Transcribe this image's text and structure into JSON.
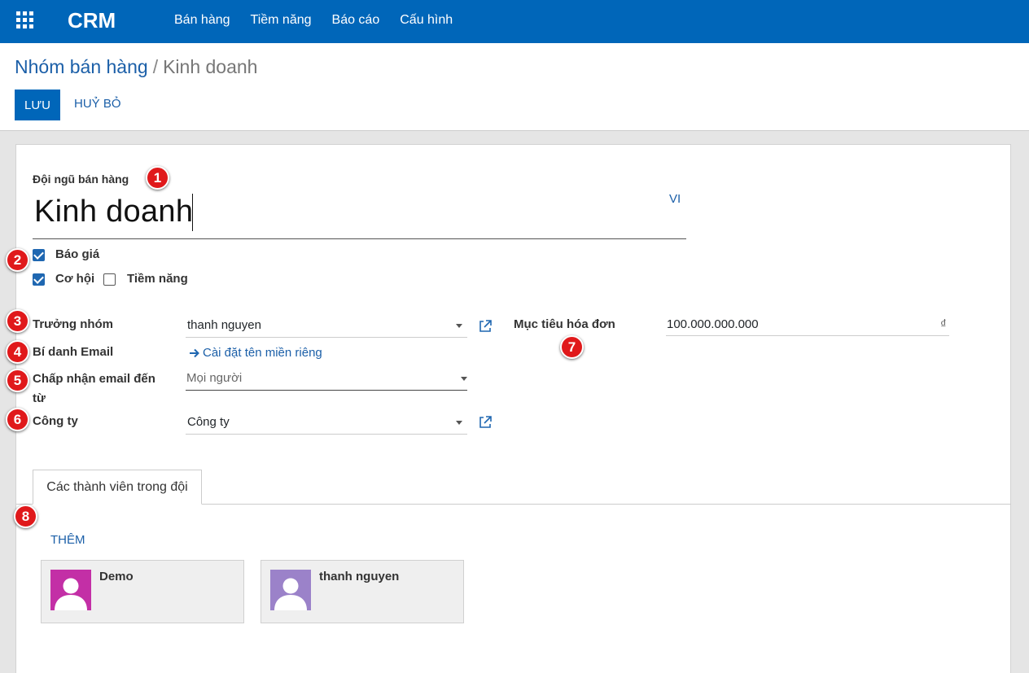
{
  "topbar": {
    "brand": "CRM",
    "menu": [
      "Bán hàng",
      "Tiềm năng",
      "Báo cáo",
      "Cấu hình"
    ]
  },
  "breadcrumb": {
    "parent": "Nhóm bán hàng",
    "separator": "/",
    "current": "Kinh doanh"
  },
  "actions": {
    "save": "LƯU",
    "discard": "HUỶ BỎ"
  },
  "form": {
    "team_label": "Đội ngũ bán hàng",
    "team_name": "Kinh doanh",
    "lang": "VI",
    "checkboxes": {
      "quotations": {
        "label": "Báo giá",
        "checked": true
      },
      "opportunities": {
        "label": "Cơ hội",
        "checked": true
      },
      "leads": {
        "label": "Tiềm năng",
        "checked": false
      }
    },
    "leader_label": "Trưởng nhóm",
    "leader_value": "thanh nguyen",
    "alias_label": "Bí danh Email",
    "alias_link": "Cài đặt tên miền riêng",
    "accept_label": "Chấp nhận email đến từ",
    "accept_value": "Mọi người",
    "company_label": "Công ty",
    "company_value": "Công ty",
    "invoice_label": "Mục tiêu hóa đơn",
    "invoice_value": "100.000.000.000",
    "currency": "₫"
  },
  "tabs": {
    "members": "Các thành viên trong đội"
  },
  "members": {
    "add_label": "THÊM",
    "list": [
      {
        "name": "Demo",
        "avatar_color": "#c32fa6"
      },
      {
        "name": "thanh nguyen",
        "avatar_color": "#9b82c9"
      }
    ]
  },
  "annotations": [
    "1",
    "2",
    "3",
    "4",
    "5",
    "6",
    "7",
    "8"
  ],
  "colors": {
    "primary": "#0066b9",
    "link": "#1b5fa8",
    "badge": "#e0191b"
  }
}
